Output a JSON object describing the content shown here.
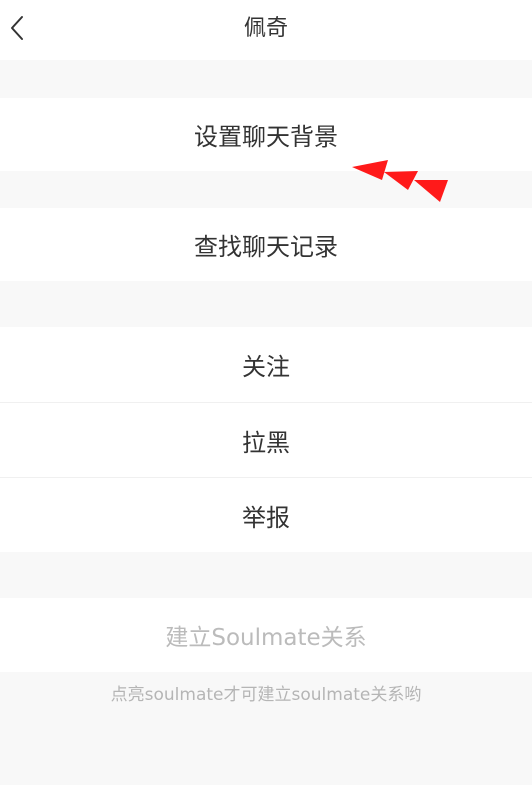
{
  "header": {
    "title": "佩奇"
  },
  "menu": {
    "set_chat_background": "设置聊天背景",
    "search_chat_history": "查找聊天记录",
    "follow": "关注",
    "block": "拉黑",
    "report": "举报"
  },
  "soulmate": {
    "button_label": "建立Soulmate关系",
    "hint": "点亮soulmate才可建立soulmate关系哟"
  },
  "colors": {
    "background": "#f8f8f8",
    "row_background": "#ffffff",
    "text_primary": "#333333",
    "text_disabled": "#bbbbbb",
    "annotation_arrow": "#ff1a1a"
  },
  "icons": {
    "back": "chevron-left-icon",
    "annotation": "triple-arrow-annotation-icon"
  }
}
